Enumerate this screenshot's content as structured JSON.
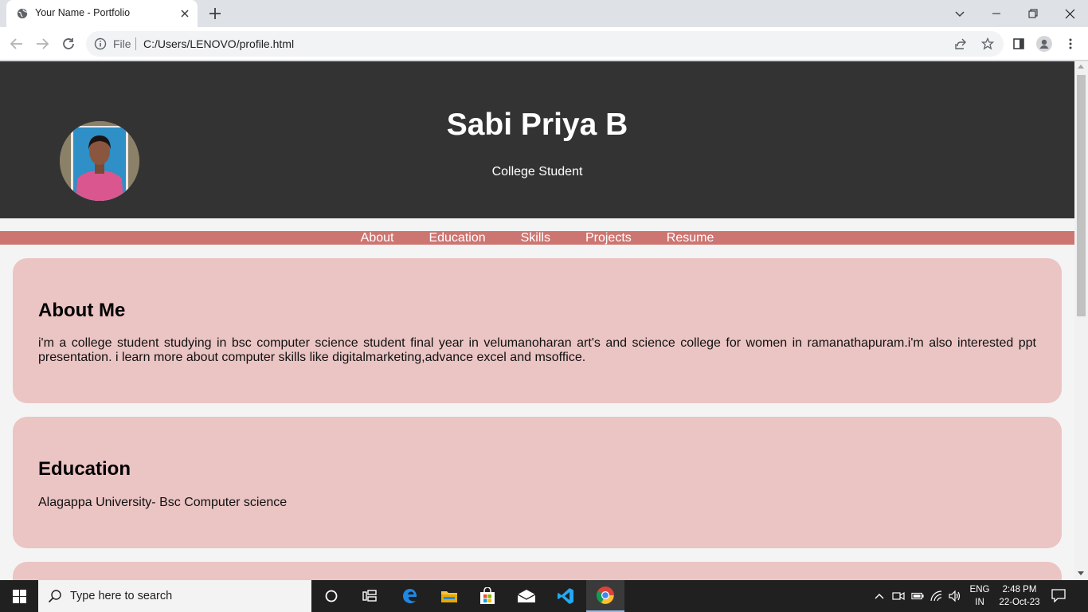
{
  "browser": {
    "tab_title": "Your Name - Portfolio",
    "scheme_label": "File",
    "url": "C:/Users/LENOVO/profile.html"
  },
  "page": {
    "hero": {
      "name": "Sabi Priya B",
      "role": "College Student"
    },
    "nav": [
      "About",
      "Education",
      "Skills",
      "Projects",
      "Resume"
    ],
    "sections": {
      "about": {
        "heading": "About Me",
        "text": "i'm a college student studying in bsc computer science student final year in velumanoharan art's and science college for women in ramanathapuram.i'm also interested ppt presentation. i learn more about computer skills like digitalmarketing,advance excel and msoffice."
      },
      "education": {
        "heading": "Education",
        "text": "Alagappa University- Bsc Computer science"
      }
    },
    "colors": {
      "hero_bg": "#333333",
      "nav_bg": "#cd7571",
      "card_bg": "#ebc4c4",
      "page_bg": "#f4f4f4"
    }
  },
  "taskbar": {
    "search_placeholder": "Type here to search",
    "lang_top": "ENG",
    "lang_bottom": "IN",
    "time": "2:48 PM",
    "date": "22-Oct-23",
    "pinned_apps": [
      "cortana-icon",
      "task-view-icon",
      "edge-icon",
      "file-explorer-icon",
      "store-icon",
      "mail-icon",
      "vscode-icon",
      "chrome-icon"
    ]
  }
}
